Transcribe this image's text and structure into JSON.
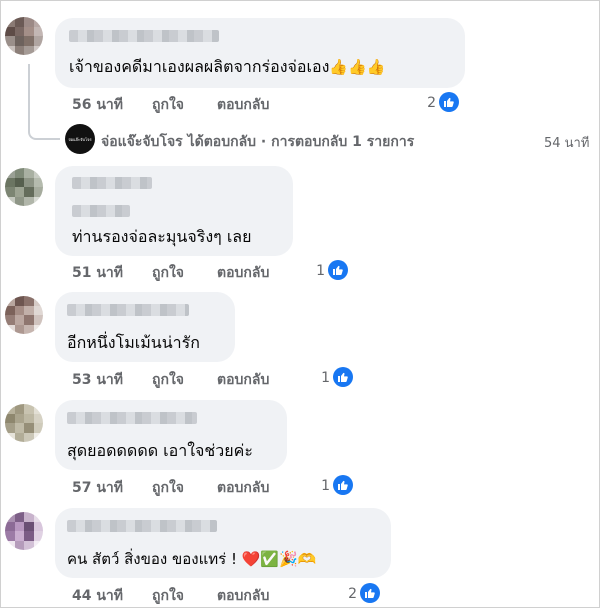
{
  "comments": [
    {
      "text": "เจ้าของคดีมาเองผลผลิตจากร่องจ่อเอง",
      "emoji": "👍👍👍",
      "time": "56 นาที",
      "like_label": "ถูกใจ",
      "reply_label": "ตอบกลับ",
      "reactions": "2"
    },
    {
      "text": "ท่านรองจ่อละมุนจริงๆ เลย",
      "time": "51 นาที",
      "like_label": "ถูกใจ",
      "reply_label": "ตอบกลับ",
      "reactions": "1"
    },
    {
      "text": "อีกหนึ่งโมเม้นน่ารัก",
      "time": "53 นาที",
      "like_label": "ถูกใจ",
      "reply_label": "ตอบกลับ",
      "reactions": "1"
    },
    {
      "text": "สุดยอดดดดด เอาใจช่วยค่ะ",
      "time": "57 นาที",
      "like_label": "ถูกใจ",
      "reply_label": "ตอบกลับ",
      "reactions": "1"
    },
    {
      "text": "คน สัตว์ สิ่งของ ของแทร่ !",
      "emoji": "❤️✅🎉🫶",
      "time": "44 นาที",
      "like_label": "ถูกใจ",
      "reply_label": "ตอบกลับ",
      "reactions": "2"
    }
  ],
  "reply_thread": {
    "author": "จ่อแจ๊ะจับโจร",
    "summary": "ได้ตอบกลับ · การตอบกลับ 1 รายการ",
    "time": "54 นาที",
    "avatar_text": "จ่อแจ๊ะจับโจร"
  },
  "colors": {
    "bubble": "#f0f2f5",
    "meta": "#65676b",
    "like_blue": "#1877f2"
  },
  "icons": {
    "reaction": "like-thumb-icon",
    "avatar": "blurred-avatar-icon"
  }
}
